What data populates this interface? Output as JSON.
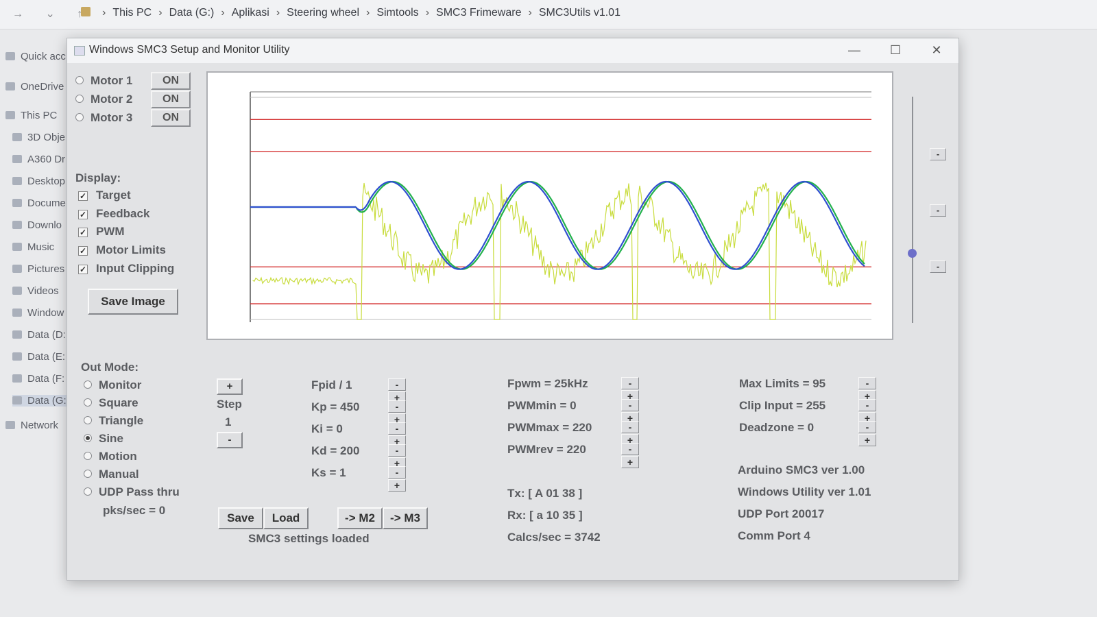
{
  "explorer": {
    "breadcrumbs": [
      "This PC",
      "Data (G:)",
      "Aplikasi",
      "Steering wheel",
      "Simtools",
      "SMC3 Frimeware",
      "SMC3Utils v1.01"
    ],
    "sidebar": [
      "Quick acc",
      "OneDrive",
      "This PC",
      "3D Obje",
      "A360 Dr",
      "Desktop",
      "Docume",
      "Downlo",
      "Music",
      "Pictures",
      "Videos",
      "Window",
      "Data (D:",
      "Data (E:",
      "Data (F:",
      "Data (G:",
      "Network"
    ]
  },
  "window": {
    "title": "Windows SMC3 Setup and Monitor Utility",
    "minimize": "—",
    "maximize": "☐",
    "close": "✕"
  },
  "motors": [
    {
      "label": "Motor 1",
      "state": "ON",
      "selected": true
    },
    {
      "label": "Motor 2",
      "state": "ON",
      "selected": false
    },
    {
      "label": "Motor 3",
      "state": "ON",
      "selected": false
    }
  ],
  "display": {
    "title": "Display:",
    "options": [
      {
        "label": "Target",
        "checked": true
      },
      {
        "label": "Feedback",
        "checked": true
      },
      {
        "label": "PWM",
        "checked": true
      },
      {
        "label": "Motor Limits",
        "checked": true
      },
      {
        "label": "Input Clipping",
        "checked": true
      }
    ],
    "save_image": "Save Image"
  },
  "out_mode": {
    "title": "Out Mode:",
    "options": [
      {
        "label": "Monitor",
        "selected": false
      },
      {
        "label": "Square",
        "selected": false
      },
      {
        "label": "Triangle",
        "selected": false
      },
      {
        "label": "Sine",
        "selected": true
      },
      {
        "label": "Motion",
        "selected": false
      },
      {
        "label": "Manual",
        "selected": false
      },
      {
        "label": "UDP Pass thru",
        "selected": false
      }
    ],
    "pks": "pks/sec = 0"
  },
  "step": {
    "plus": "+",
    "label": "Step",
    "value": "1",
    "minus": "-"
  },
  "pid": {
    "fpid": "Fpid / 1",
    "kp": "Kp = 450",
    "ki": "Ki = 0",
    "kd": "Kd = 200",
    "ks": "Ks = 1"
  },
  "pwm": {
    "fpwm": "Fpwm = 25kHz",
    "pwmmin": "PWMmin = 0",
    "pwmmax": "PWMmax = 220",
    "pwmrev": "PWMrev = 220"
  },
  "limits": {
    "max": "Max Limits = 95",
    "clip": "Clip Input = 255",
    "deadzone": "Deadzone = 0"
  },
  "buttons": {
    "save": "Save",
    "load": "Load",
    "to_m2": "-> M2",
    "to_m3": "-> M3",
    "minus": "-",
    "plus": "+"
  },
  "status": "SMC3 settings loaded",
  "comms": {
    "tx": "Tx: [ A 01 38 ]",
    "rx": "Rx: [ a 10 35 ]",
    "calcs": "Calcs/sec = 3742"
  },
  "info": {
    "arduino": "Arduino SMC3 ver 1.00",
    "utility": "Windows Utility ver 1.01",
    "udp": "UDP Port 20017",
    "comm": "Comm Port 4"
  },
  "colors": {
    "target": "#2f4fd0",
    "feedback": "#22b14c",
    "pwm": "#c8dc3c",
    "limits": "#d43030",
    "clip": "#bcbcbc",
    "slider_thumb": "#6d6fc9"
  },
  "graph": {
    "flat_level": 0.5,
    "start_fraction": 0.17,
    "cycles": 3.7
  }
}
